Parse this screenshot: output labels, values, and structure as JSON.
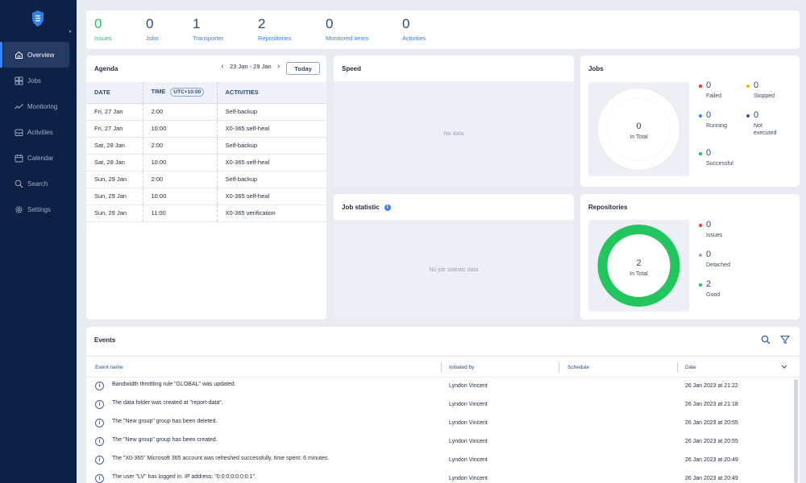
{
  "sidebar": {
    "items": [
      {
        "label": "Overview",
        "icon": "home-icon"
      },
      {
        "label": "Jobs",
        "icon": "grid-icon"
      },
      {
        "label": "Monitoring",
        "icon": "chart-icon"
      },
      {
        "label": "Activities",
        "icon": "inbox-icon"
      },
      {
        "label": "Calendar",
        "icon": "calendar-icon"
      },
      {
        "label": "Search",
        "icon": "search-icon"
      },
      {
        "label": "Settings",
        "icon": "gear-icon"
      }
    ]
  },
  "stats": [
    {
      "value": "0",
      "label": "Issues"
    },
    {
      "value": "0",
      "label": "Jobs"
    },
    {
      "value": "1",
      "label": "Transporter"
    },
    {
      "value": "2",
      "label": "Repositories"
    },
    {
      "value": "0",
      "label": "Monitored items"
    },
    {
      "value": "0",
      "label": "Activities"
    }
  ],
  "agenda": {
    "title": "Agenda",
    "range": "23 Jan - 29 Jan",
    "today_label": "Today",
    "headers": {
      "date": "DATE",
      "time": "TIME",
      "utc": "UTC+10:00",
      "activities": "ACTIVITIES"
    },
    "rows": [
      {
        "date": "Fri, 27 Jan",
        "time": "2:00",
        "activity": "Self-backup"
      },
      {
        "date": "Fri, 27 Jan",
        "time": "10:00",
        "activity": "X0-365 self-heal"
      },
      {
        "date": "Sat, 28 Jan",
        "time": "2:00",
        "activity": "Self-backup"
      },
      {
        "date": "Sat, 28 Jan",
        "time": "10:00",
        "activity": "X0-365 self-heal"
      },
      {
        "date": "Sun, 29 Jan",
        "time": "2:00",
        "activity": "Self-backup"
      },
      {
        "date": "Sun, 29 Jan",
        "time": "10:00",
        "activity": "X0-365 self-heal"
      },
      {
        "date": "Sun, 29 Jan",
        "time": "11:00",
        "activity": "X0-365 verification"
      }
    ]
  },
  "speed": {
    "title": "Speed",
    "empty": "No data"
  },
  "job_statistic": {
    "title": "Job statistic",
    "empty": "No job statistic data"
  },
  "jobs": {
    "title": "Jobs",
    "total_value": "0",
    "total_label": "In Total",
    "legend": [
      {
        "value": "0",
        "label": "Failed",
        "color": "#e53935"
      },
      {
        "value": "0",
        "label": "Stopped",
        "color": "#f2b600"
      },
      {
        "value": "0",
        "label": "Running",
        "color": "#3b82f6"
      },
      {
        "value": "0",
        "label": "Not executed",
        "color": "#2b5ea8"
      },
      {
        "value": "0",
        "label": "Successful",
        "color": "#1fbf6a"
      }
    ]
  },
  "repositories": {
    "title": "Repositories",
    "total_value": "2",
    "total_label": "In Total",
    "ring_color": "#22c55e",
    "legend": [
      {
        "value": "0",
        "label": "Issues",
        "color": "#e53935"
      },
      {
        "value": "0",
        "label": "Detached",
        "color": "#8fa8cc"
      },
      {
        "value": "2",
        "label": "Good",
        "color": "#1fbf6a"
      }
    ]
  },
  "events": {
    "title": "Events",
    "columns": {
      "name": "Event name",
      "by": "Initiated by",
      "schedule": "Schedule",
      "date": "Date"
    },
    "rows": [
      {
        "name": "Bandwidth throttling rule \"GLOBAL\" was updated.",
        "by": "Lyndon Vincent",
        "date": "26 Jan 2023 at 21:22"
      },
      {
        "name": "The data folder was created at \"report-data\".",
        "by": "Lyndon Vincent",
        "date": "26 Jan 2023 at 21:18"
      },
      {
        "name": "The \"New group\" group has been deleted.",
        "by": "Lyndon Vincent",
        "date": "26 Jan 2023 at 20:55"
      },
      {
        "name": "The \"New group\" group has been created.",
        "by": "Lyndon Vincent",
        "date": "26 Jan 2023 at 20:55"
      },
      {
        "name": "The \"X0-365\" Microsoft 365 account was refreshed successfully, time spent: 6 minutes.",
        "by": "Lyndon Vincent",
        "date": "26 Jan 2023 at 20:49"
      },
      {
        "name": "The user \"LV\" has logged in. IP address: \"0:0:0:0:0:0:0:1\".",
        "by": "Lyndon Vincent",
        "date": "26 Jan 2023 at 20:49"
      }
    ]
  }
}
